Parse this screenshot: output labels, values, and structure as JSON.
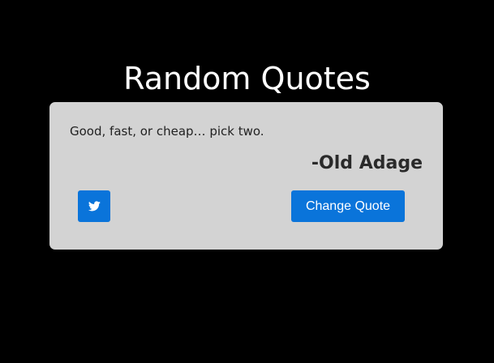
{
  "page": {
    "title": "Random Quotes"
  },
  "quote": {
    "text": "Good, fast, or cheap… pick two.",
    "author": "-Old Adage"
  },
  "actions": {
    "tweet_icon": "twitter-bird-icon",
    "change_label": "Change Quote"
  },
  "colors": {
    "background": "#000000",
    "card": "#d3d3d3",
    "accent": "#0a74da",
    "title_text": "#ffffff"
  }
}
